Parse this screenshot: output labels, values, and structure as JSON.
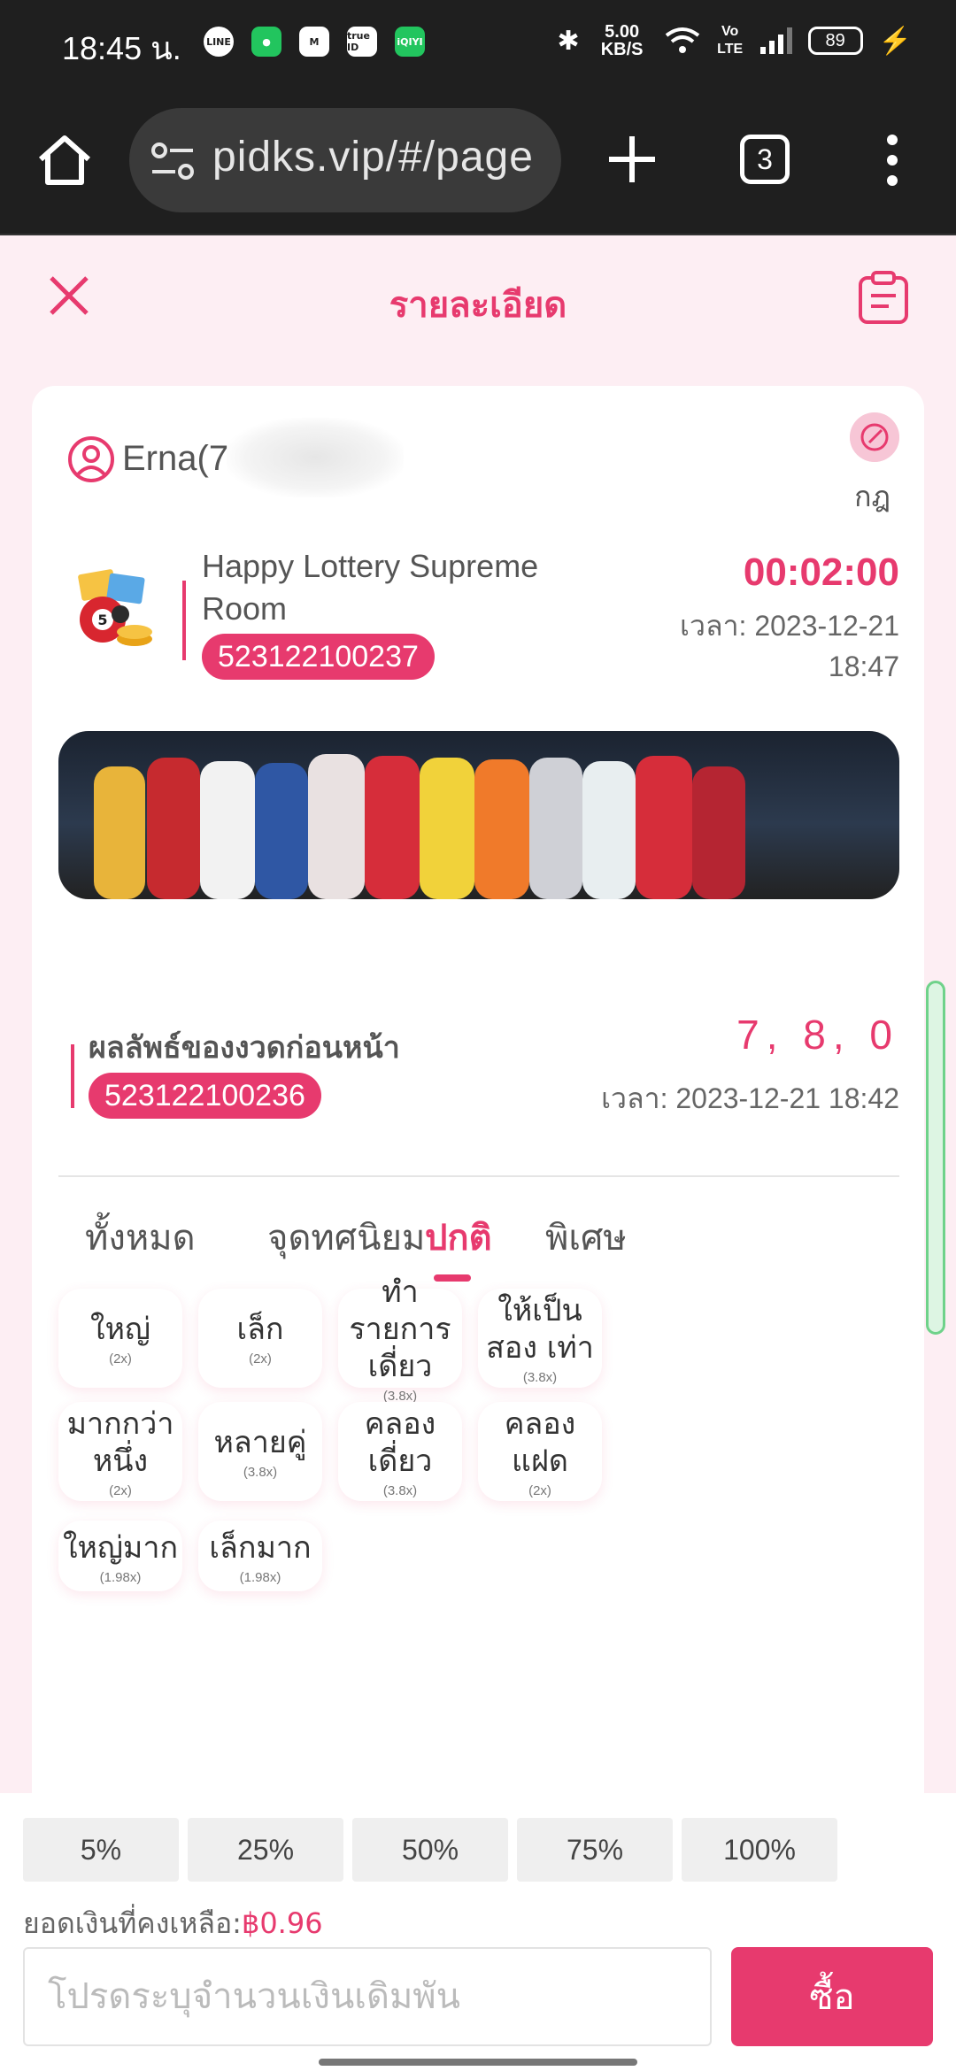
{
  "status_bar": {
    "time": "18:45 น.",
    "apps": [
      "LINE",
      "chat",
      "M",
      "true ID",
      "iQIYI"
    ],
    "net_speed": "5.00 KB/S",
    "volte": "Vo LTE",
    "battery": "89"
  },
  "browser": {
    "url": "pidks.vip/#/page",
    "tab_count": "3"
  },
  "header": {
    "title": "รายละเอียด"
  },
  "user": {
    "name": "Erna(7",
    "rule_label": "กฎ"
  },
  "room": {
    "name": "Happy Lottery Supreme Room",
    "issue_number": "523122100237",
    "countdown": "00:02:00",
    "time_label": "เวลา: 2023-12-21 18:47"
  },
  "previous": {
    "label": "ผลลัพธ์ของงวดก่อนหน้า",
    "issue_number": "523122100236",
    "result": "7, 8, 0",
    "time_label": "เวลา: 2023-12-21 18:42"
  },
  "tabs": [
    {
      "label": "ทั้งหมด"
    },
    {
      "label": "จุดทศนิยม"
    },
    {
      "label": "ปกติ"
    },
    {
      "label": "พิเศษ"
    }
  ],
  "active_tab": "ปกติ",
  "bets": [
    {
      "name": "ใหญ่",
      "odds": "(2x)"
    },
    {
      "name": "เล็ก",
      "odds": "(2x)"
    },
    {
      "name": "ทำรายการ เดี่ยว",
      "odds": "(3.8x)"
    },
    {
      "name": "ให้เป็นสอง เท่า",
      "odds": "(3.8x)"
    },
    {
      "name": "มากกว่า หนึ่ง",
      "odds": "(2x)"
    },
    {
      "name": "หลายคู่",
      "odds": "(3.8x)"
    },
    {
      "name": "คลองเดี่ยว",
      "odds": "(3.8x)"
    },
    {
      "name": "คลองแฝด",
      "odds": "(2x)"
    },
    {
      "name": "ใหญ่มาก",
      "odds": "(1.98x)"
    },
    {
      "name": "เล็กมาก",
      "odds": "(1.98x)"
    }
  ],
  "bottom": {
    "percent_buttons": [
      "5%",
      "25%",
      "50%",
      "75%",
      "100%"
    ],
    "balance_label": "ยอดเงินที่คงเหลือ:",
    "balance_value": "฿0.96",
    "amount_placeholder": "โปรดระบุจำนวนเงินเดิมพัน",
    "buy_label": "ซื้อ"
  },
  "colors": {
    "accent": "#e73a6e",
    "page_bg": "#fdeef3"
  }
}
